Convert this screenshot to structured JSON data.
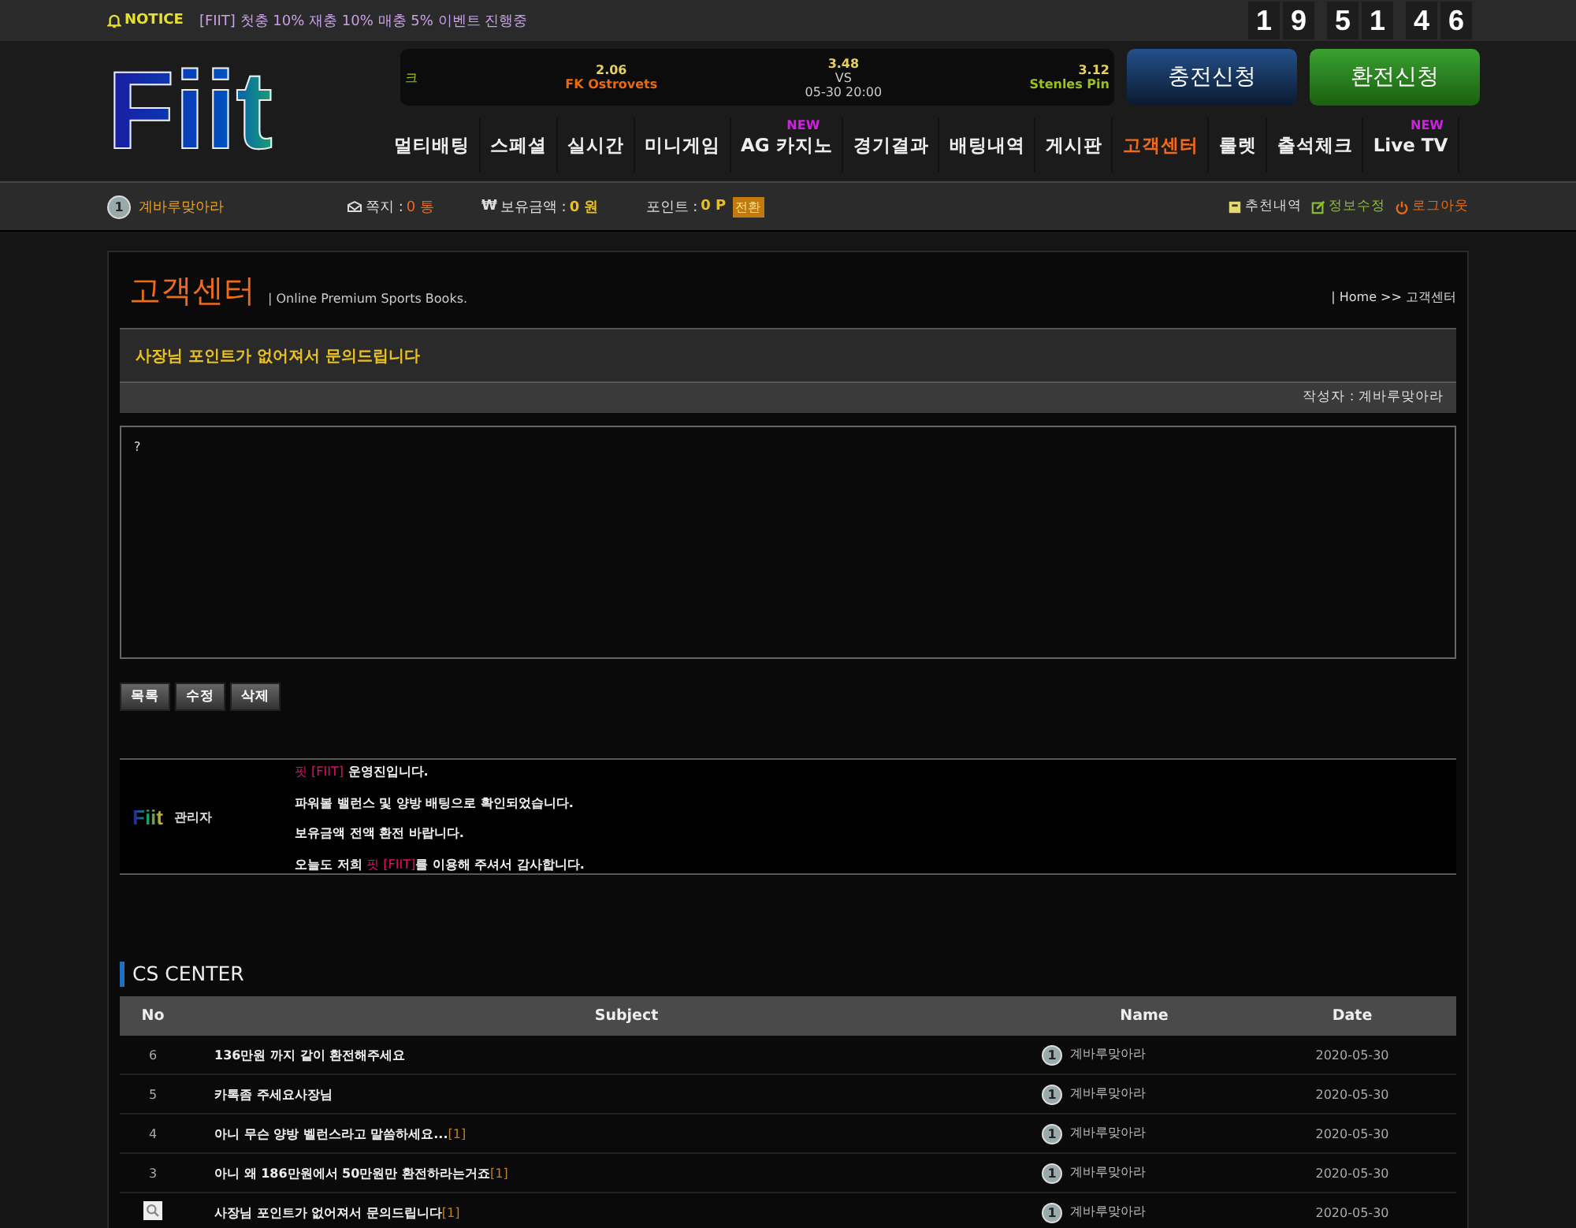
{
  "notice": {
    "label": "NOTICE",
    "text": "[FIIT] 첫충 10% 재충 10% 매충 5% 이벤트 진행중"
  },
  "clock": {
    "digits": [
      "1",
      "9",
      "5",
      "1",
      "4",
      "6"
    ]
  },
  "logo": {
    "text": "Fiit"
  },
  "match": {
    "home_cut": "크",
    "home_odds": "2.06",
    "home": "FK Ostrovets",
    "draw_odds": "3.48",
    "vs": "VS",
    "time": "05-30 20:00",
    "away_odds": "3.12",
    "away": "Stenles Pin"
  },
  "header_buttons": [
    {
      "label": "충전신청",
      "kind": "deposit"
    },
    {
      "label": "환전신청",
      "kind": "withdraw"
    }
  ],
  "nav": [
    {
      "label": "멀티배팅",
      "selected": false
    },
    {
      "label": "스페셜",
      "selected": false
    },
    {
      "label": "실시간",
      "selected": false
    },
    {
      "label": "미니게임",
      "selected": false
    },
    {
      "label": "AG 카지노",
      "selected": false,
      "badge": "NEW"
    },
    {
      "label": "경기결과",
      "selected": false
    },
    {
      "label": "배팅내역",
      "selected": false
    },
    {
      "label": "게시판",
      "selected": false
    },
    {
      "label": "고객센터",
      "selected": true
    },
    {
      "label": "룰렛",
      "selected": false
    },
    {
      "label": "출석체크",
      "selected": false
    },
    {
      "label": "Live TV",
      "selected": false,
      "badge": "NEW"
    }
  ],
  "info_bar": {
    "level": "1",
    "username": "계바루맞아라",
    "memo_label": "쪽지 : ",
    "memo_value": "0 통",
    "money_icon": "₩",
    "money_label": "보유금액 : ",
    "money_value": "0 원",
    "points_label": "포인트 : ",
    "points_value": "0 P",
    "convert": "전환",
    "links": [
      {
        "label": "추천내역",
        "kind": "recommend"
      },
      {
        "label": "정보수정",
        "kind": "edit"
      },
      {
        "label": "로그아웃",
        "kind": "logout"
      }
    ]
  },
  "page": {
    "title": "고객센터",
    "subtitle": "| Online Premium Sports Books.",
    "breadcrumb": "| Home",
    "breadcrumb_separator": ">>",
    "breadcrumb_current": "고객센터"
  },
  "post": {
    "title": "사장님 포인트가 없어져서 문의드립니다",
    "author": "작성자 : 계바루맞아라",
    "body": "?"
  },
  "actions": [
    "목록",
    "수정",
    "삭제"
  ],
  "reply": {
    "logo": "Fiit",
    "author": "관리자",
    "lines": [
      [
        {
          "text": "핏 [FIIT]",
          "highlight": true
        },
        {
          "text": " 운영진입니다.",
          "highlight": false
        }
      ],
      [
        {
          "text": "파워볼 밸런스 및 양방 배팅으로 확인되었습니다.",
          "highlight": false
        }
      ],
      [
        {
          "text": "보유금액 전액 환전 바랍니다.",
          "highlight": false
        }
      ],
      [
        {
          "text": "오늘도 저희 ",
          "highlight": false
        },
        {
          "text": "핏 [FIIT]",
          "highlight": true
        },
        {
          "text": "를 이용해 주셔서 감사합니다.",
          "highlight": false
        }
      ]
    ]
  },
  "cs": {
    "title": "CS CENTER",
    "columns": [
      "No",
      "Subject",
      "Name",
      "Date"
    ],
    "rows": [
      {
        "no": "6",
        "subject": "136만원 까지 같이 환전해주세요",
        "comments": "",
        "level": "1",
        "name": "계바루맞아라",
        "date": "2020-05-30",
        "current": false
      },
      {
        "no": "5",
        "subject": "카톡좀 주세요사장님",
        "comments": "",
        "level": "1",
        "name": "계바루맞아라",
        "date": "2020-05-30",
        "current": false
      },
      {
        "no": "4",
        "subject": "아니 무슨 양방 벨런스라고 말씀하세요...",
        "comments": "[1]",
        "level": "1",
        "name": "계바루맞아라",
        "date": "2020-05-30",
        "current": false
      },
      {
        "no": "3",
        "subject": "아니 왜 186만원에서 50만원만 환전하라는거죠",
        "comments": "[1]",
        "level": "1",
        "name": "계바루맞아라",
        "date": "2020-05-30",
        "current": false
      },
      {
        "no": "",
        "subject": "사장님 포인트가 없어져서 문의드립니다",
        "comments": "[1]",
        "level": "1",
        "name": "계바루맞아라",
        "date": "2020-05-30",
        "current": true
      }
    ]
  }
}
